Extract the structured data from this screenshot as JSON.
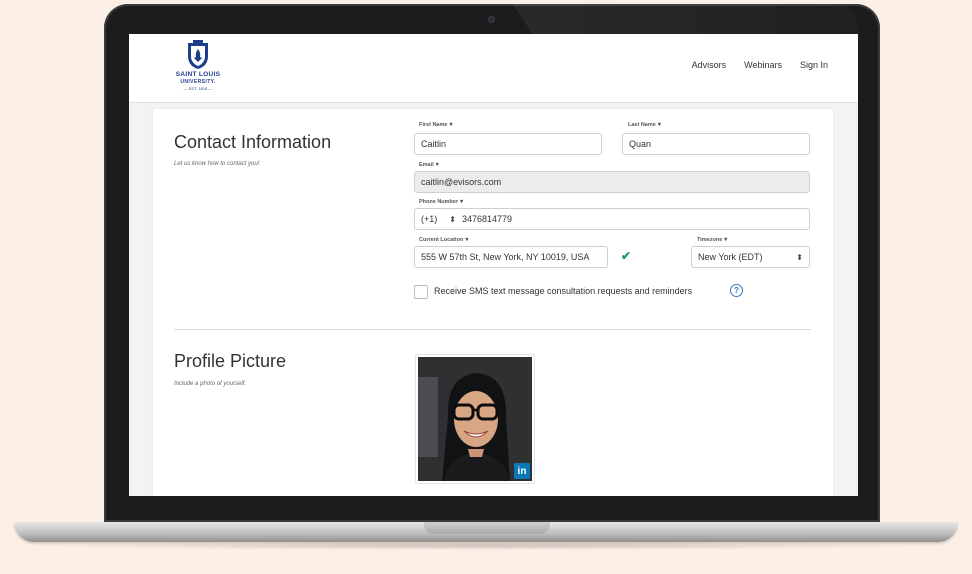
{
  "header": {
    "logo": {
      "line1": "SAINT LOUIS",
      "line2": "UNIVERSITY.",
      "line3": "— EST. 1818 —"
    },
    "nav": [
      "Advisors",
      "Webinars",
      "Sign In"
    ]
  },
  "contact": {
    "title": "Contact Information",
    "subtitle": "Let us know how to contact you!",
    "first_name": {
      "label": "First Name",
      "value": "Caitlin"
    },
    "last_name": {
      "label": "Last Name",
      "value": "Quan"
    },
    "email": {
      "label": "Email",
      "value": "caitlin@evisors.com"
    },
    "phone": {
      "label": "Phone Number",
      "code": "(+1)",
      "value": "3476814779"
    },
    "location": {
      "label": "Current Location",
      "value": "555 W 57th St, New York, NY 10019, USA"
    },
    "timezone": {
      "label": "Timezone",
      "value": "New York (EDT)"
    },
    "sms_label": "Receive SMS text message consultation requests and reminders"
  },
  "profile": {
    "title": "Profile Picture",
    "subtitle": "Include a photo of yourself.",
    "badge": "in"
  },
  "colors": {
    "accent": "#2f79c8",
    "success": "#1aa05a",
    "linkedin": "#0a78b5",
    "brand": "#1f3e8a"
  }
}
